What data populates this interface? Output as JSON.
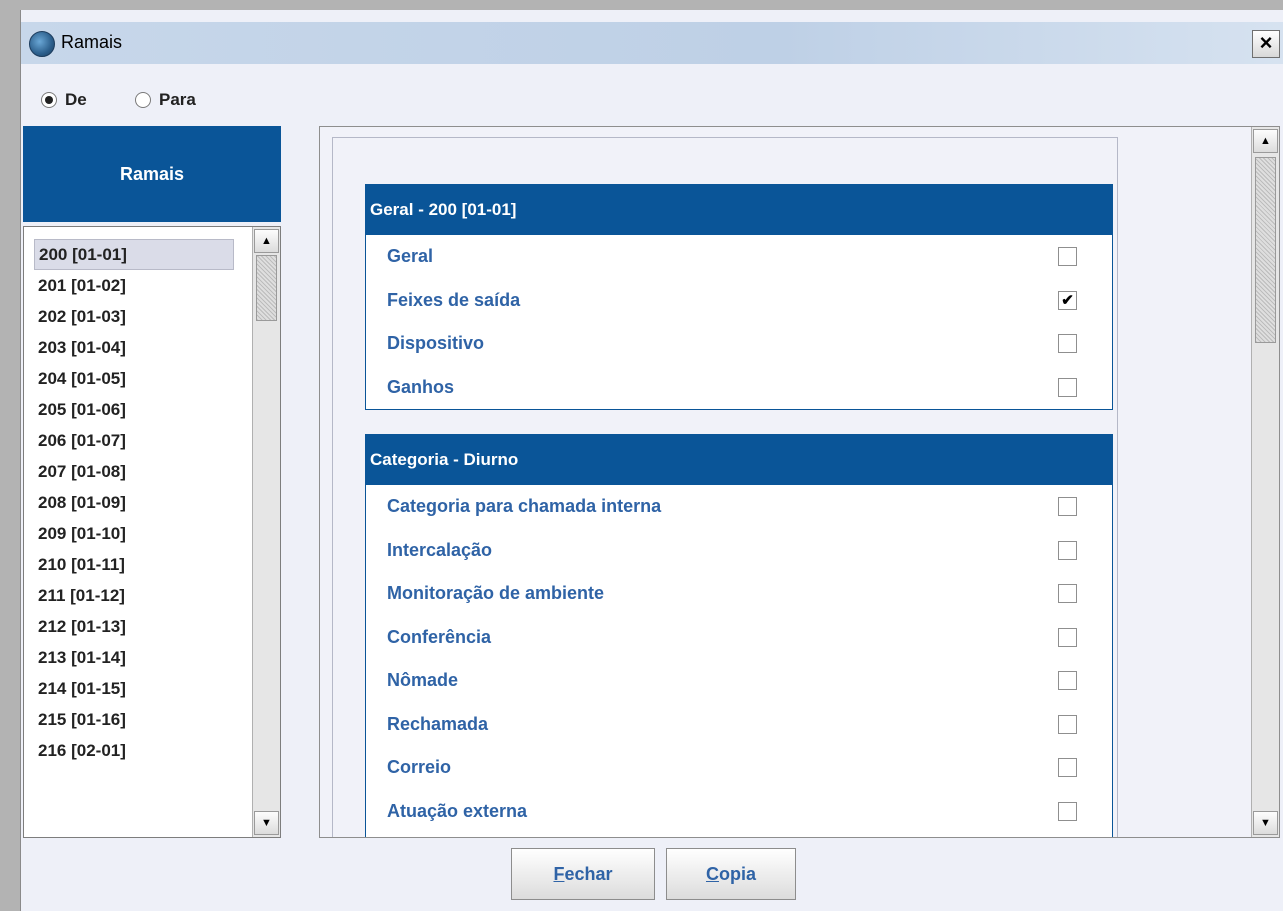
{
  "window": {
    "title": "Ramais",
    "close_label": "×"
  },
  "direction": {
    "de_label": "De",
    "para_label": "Para",
    "selected": "De"
  },
  "ramais": {
    "header": "Ramais",
    "items": [
      "200 [01-01]",
      "201 [01-02]",
      "202 [01-03]",
      "203 [01-04]",
      "204 [01-05]",
      "205 [01-06]",
      "206 [01-07]",
      "207 [01-08]",
      "208 [01-09]",
      "209 [01-10]",
      "210 [01-11]",
      "211 [01-12]",
      "212 [01-13]",
      "213 [01-14]",
      "214 [01-15]",
      "215 [01-16]",
      "216 [02-01]"
    ],
    "selected_index": 0
  },
  "sections": [
    {
      "title": "Geral - 200 [01-01]",
      "options": [
        {
          "label": "Geral",
          "checked": false
        },
        {
          "label": "Feixes de saída",
          "checked": true
        },
        {
          "label": "Dispositivo",
          "checked": false
        },
        {
          "label": "Ganhos",
          "checked": false
        }
      ]
    },
    {
      "title": "Categoria - Diurno",
      "options": [
        {
          "label": "Categoria para chamada interna",
          "checked": false
        },
        {
          "label": "Intercalação",
          "checked": false
        },
        {
          "label": "Monitoração de ambiente",
          "checked": false
        },
        {
          "label": "Conferência",
          "checked": false
        },
        {
          "label": "Nômade",
          "checked": false
        },
        {
          "label": "Rechamada",
          "checked": false
        },
        {
          "label": "Correio",
          "checked": false
        },
        {
          "label": "Atuação externa",
          "checked": false
        }
      ]
    }
  ],
  "buttons": {
    "fechar": {
      "mnemonic": "F",
      "rest": "echar"
    },
    "copia": {
      "mnemonic": "C",
      "rest": "opia"
    }
  },
  "colors": {
    "header_blue": "#0a5598",
    "label_blue": "#2f63a6",
    "background": "#eef0f8"
  }
}
